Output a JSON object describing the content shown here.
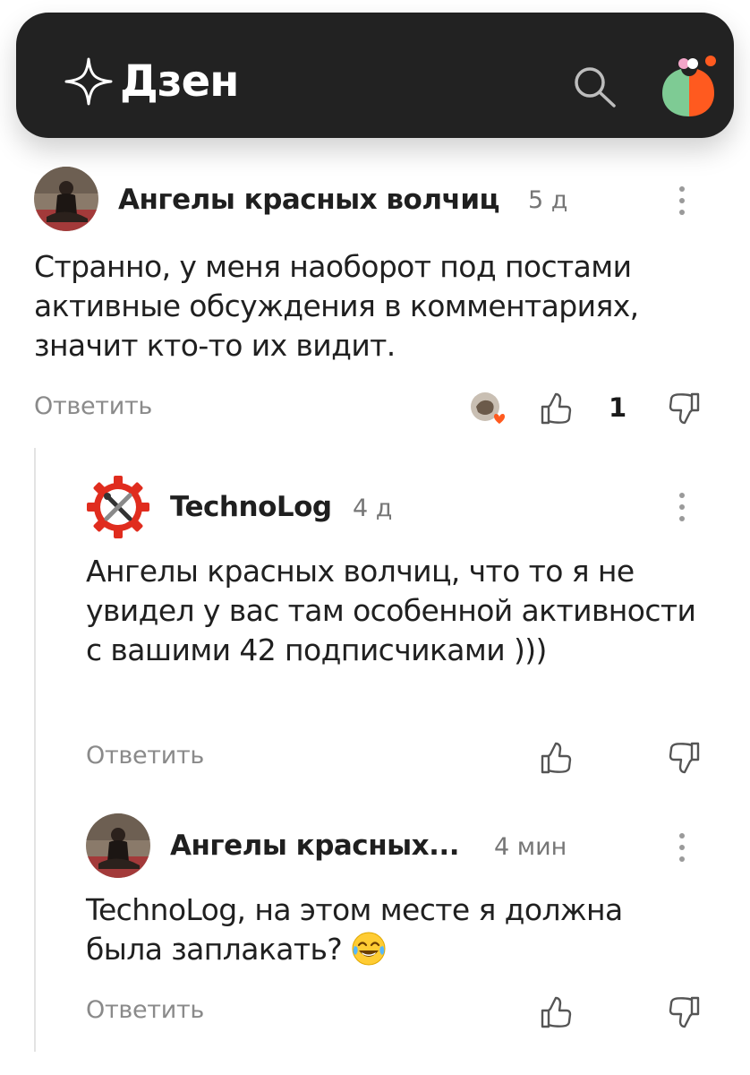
{
  "header": {
    "logo_text": "Дзен",
    "search_icon": "search-icon",
    "account_icon": "account-avatar-icon"
  },
  "comments": [
    {
      "author": "Ангелы красных волчиц",
      "time": "5 д",
      "text": "Странно, у меня наоборот под постами активные обсуждения в комментариях, значит кто-то их видит.",
      "reply_label": "Ответить",
      "likes": "1"
    },
    {
      "author": "TechnoLog",
      "time": "4 д",
      "text": "Ангелы красных волчиц, что то я не увидел у вас там особенной активности с вашими 42 подписчиками )))",
      "reply_label": "Ответить"
    },
    {
      "author": "Ангелы красных...",
      "time": "4 мин",
      "text": "TechnoLog, на этом месте я должна была заплакать?",
      "emoji": "😂",
      "reply_label": "Ответить"
    }
  ],
  "colors": {
    "header_bg": "#222222",
    "accent_orange": "#ff5a1f",
    "accent_green": "#7ecb94",
    "muted_text": "#8a8a8a"
  }
}
